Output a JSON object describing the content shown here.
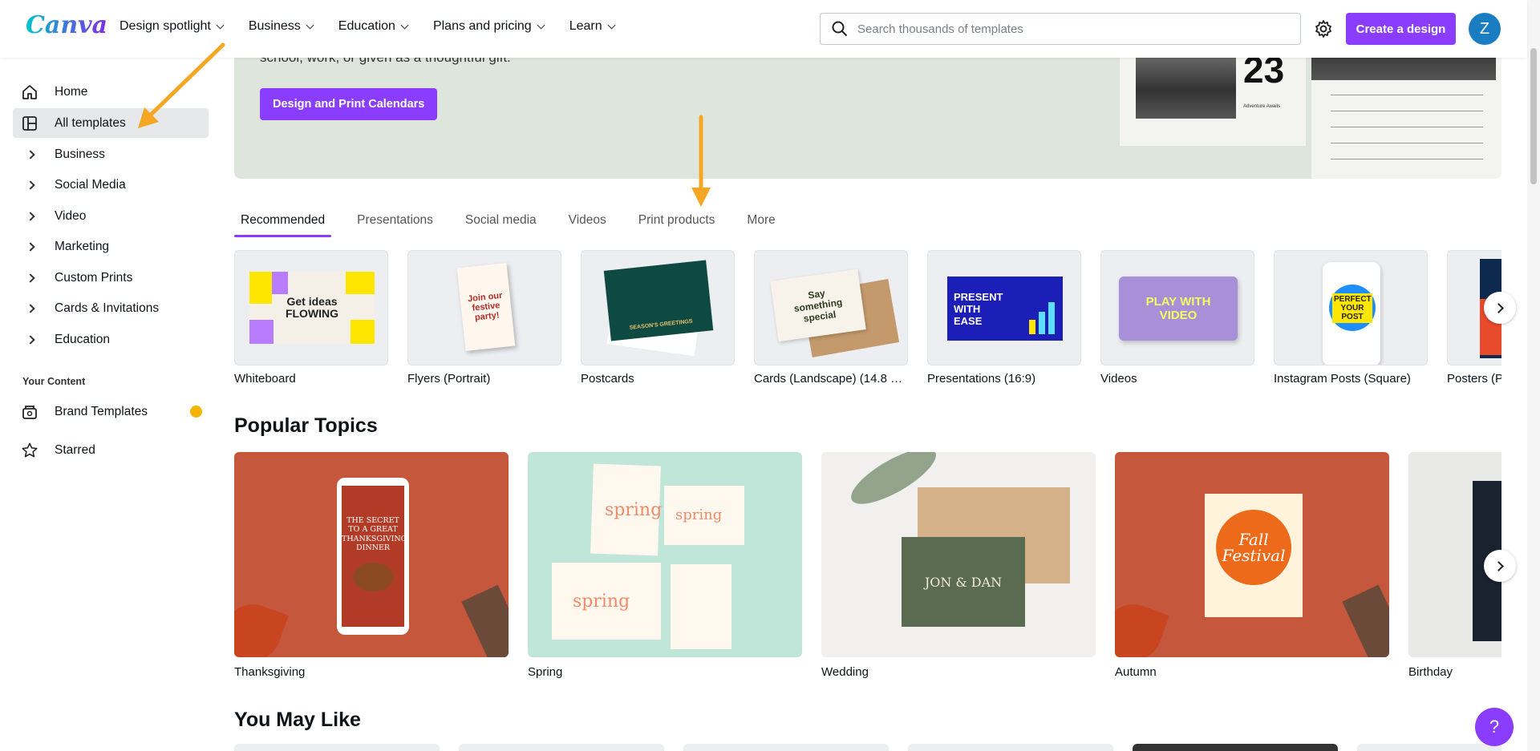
{
  "header": {
    "logo": "Canva",
    "nav": [
      {
        "label": "Design spotlight"
      },
      {
        "label": "Business"
      },
      {
        "label": "Education"
      },
      {
        "label": "Plans and pricing"
      },
      {
        "label": "Learn"
      }
    ],
    "search_placeholder": "Search thousands of templates",
    "create_label": "Create a design",
    "avatar_initial": "Z"
  },
  "sidebar": {
    "items": [
      {
        "label": "Home",
        "icon": "home-icon"
      },
      {
        "label": "All templates",
        "icon": "templates-icon"
      },
      {
        "label": "Business"
      },
      {
        "label": "Social Media"
      },
      {
        "label": "Video"
      },
      {
        "label": "Marketing"
      },
      {
        "label": "Custom Prints"
      },
      {
        "label": "Cards & Invitations"
      },
      {
        "label": "Education"
      }
    ],
    "heading": "Your Content",
    "content_items": [
      {
        "label": "Brand Templates",
        "icon": "brand-templates-icon"
      },
      {
        "label": "Starred",
        "icon": "star-icon"
      }
    ]
  },
  "banner": {
    "text": "school, work, or given as a thoughtful gift.",
    "button_label": "Design and Print Calendars",
    "calendar_number": "23",
    "calendar_caption": "Adventure Awaits"
  },
  "tabs": [
    {
      "label": "Recommended"
    },
    {
      "label": "Presentations"
    },
    {
      "label": "Social media"
    },
    {
      "label": "Videos"
    },
    {
      "label": "Print products"
    },
    {
      "label": "More"
    }
  ],
  "categories": [
    {
      "label": "Whiteboard",
      "thumb_text": "Get ideas FLOWING"
    },
    {
      "label": "Flyers (Portrait)",
      "thumb_text": "Join our festive party!"
    },
    {
      "label": "Postcards",
      "thumb_text": "SEASON'S GREETINGS"
    },
    {
      "label": "Cards (Landscape) (14.8 × …",
      "thumb_text": "Say something special"
    },
    {
      "label": "Presentations (16:9)",
      "thumb_text": "PRESENT WITH EASE"
    },
    {
      "label": "Videos",
      "thumb_text": "PLAY WITH VIDEO"
    },
    {
      "label": "Instagram Posts (Square)",
      "thumb_text": "PERFECT YOUR POST"
    },
    {
      "label": "Posters (P",
      "thumb_text": ""
    }
  ],
  "popular_topics_title": "Popular Topics",
  "topics": [
    {
      "label": "Thanksgiving",
      "thumb_text": "THE SECRET TO A GREAT THANKSGIVING DINNER"
    },
    {
      "label": "Spring",
      "thumb_text": "spring"
    },
    {
      "label": "Wedding",
      "thumb_text": "JON & DAN"
    },
    {
      "label": "Autumn",
      "thumb_text": "Fall Festival"
    },
    {
      "label": "Birthday",
      "thumb_text": ""
    }
  ],
  "you_may_like_title": "You May Like",
  "help_label": "?",
  "colors": {
    "brand": "#8b3dff",
    "annotation": "#f5a623"
  }
}
